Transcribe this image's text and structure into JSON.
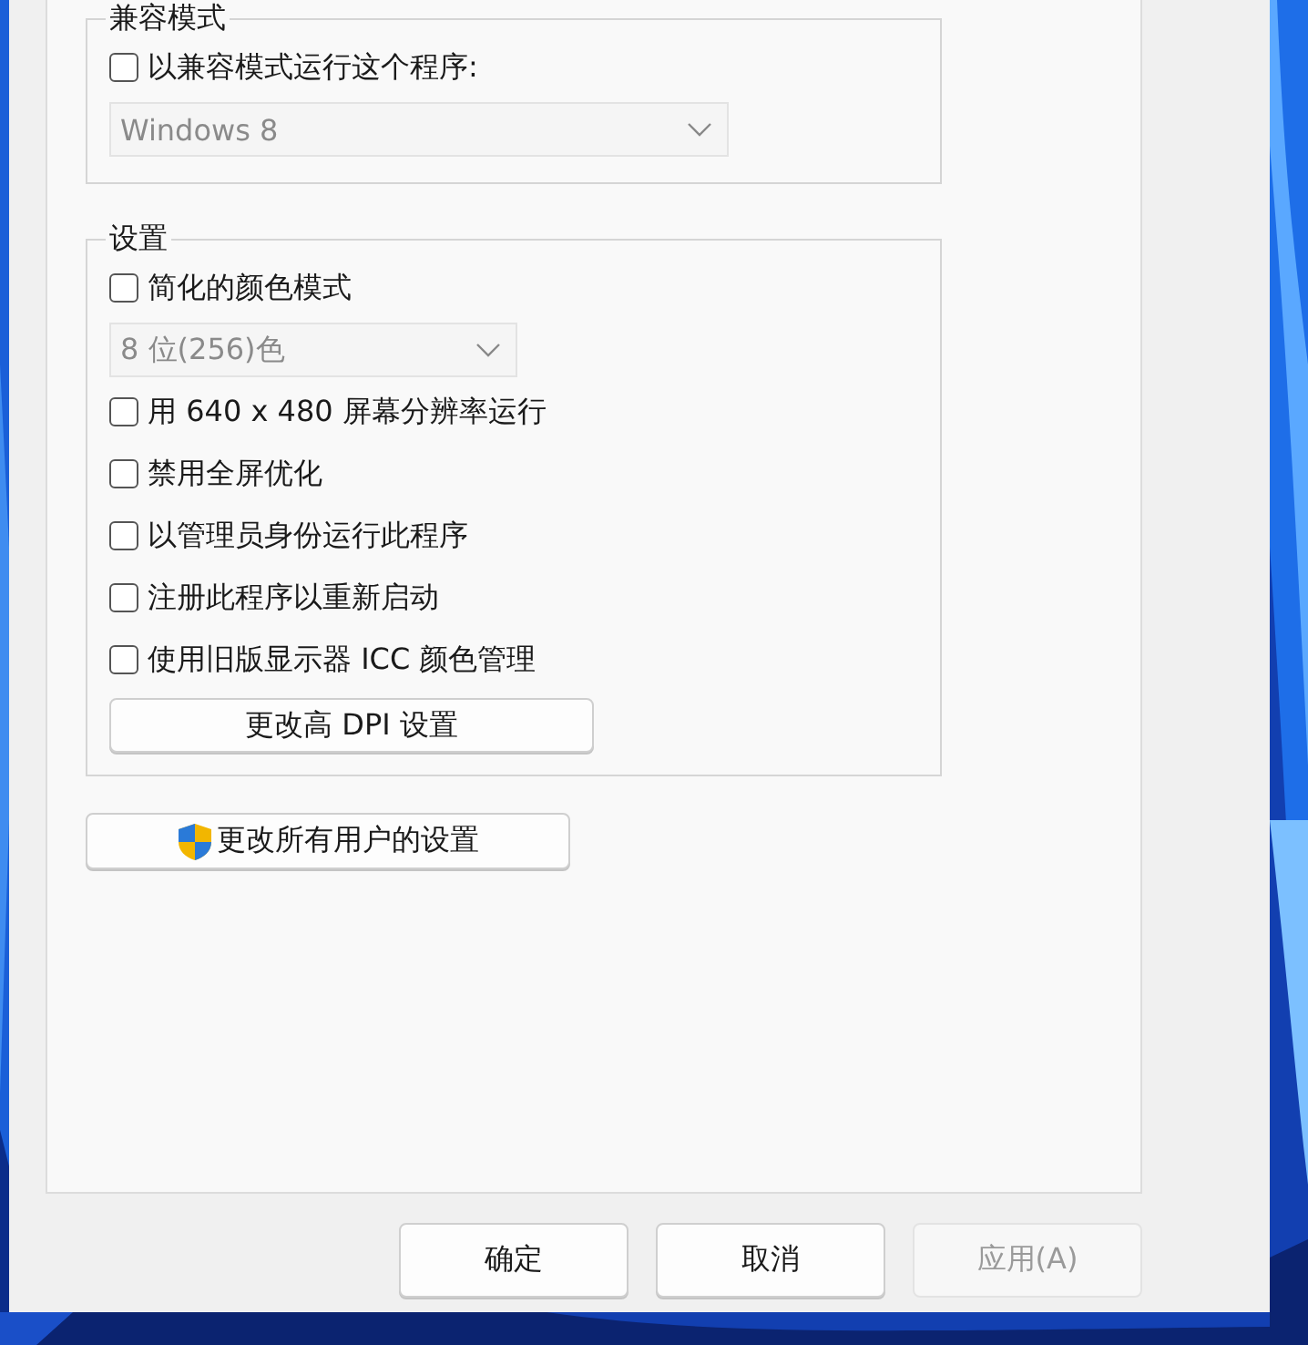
{
  "compat_group": {
    "title": "兼容模式",
    "checkbox": {
      "label": "以兼容模式运行这个程序:",
      "checked": false
    },
    "dropdown": {
      "value": "Windows 8",
      "disabled": true
    }
  },
  "settings_group": {
    "title": "设置",
    "items": [
      {
        "kind": "checkbox",
        "label": "简化的颜色模式",
        "checked": false
      },
      {
        "kind": "dropdown",
        "value": "8 位(256)色",
        "disabled": true
      },
      {
        "kind": "checkbox",
        "label": "用 640 x 480 屏幕分辨率运行",
        "checked": false
      },
      {
        "kind": "checkbox",
        "label": "禁用全屏优化",
        "checked": false
      },
      {
        "kind": "checkbox",
        "label": "以管理员身份运行此程序",
        "checked": false
      },
      {
        "kind": "checkbox",
        "label": "注册此程序以重新启动",
        "checked": false
      },
      {
        "kind": "checkbox",
        "label": "使用旧版显示器 ICC 颜色管理",
        "checked": false
      },
      {
        "kind": "button",
        "label": "更改高 DPI 设置"
      }
    ]
  },
  "all_users_button": {
    "label": "更改所有用户的设置"
  },
  "buttons": [
    {
      "label": "确定",
      "disabled": false
    },
    {
      "label": "取消",
      "disabled": false
    },
    {
      "label": "应用(A)",
      "disabled": true
    }
  ]
}
